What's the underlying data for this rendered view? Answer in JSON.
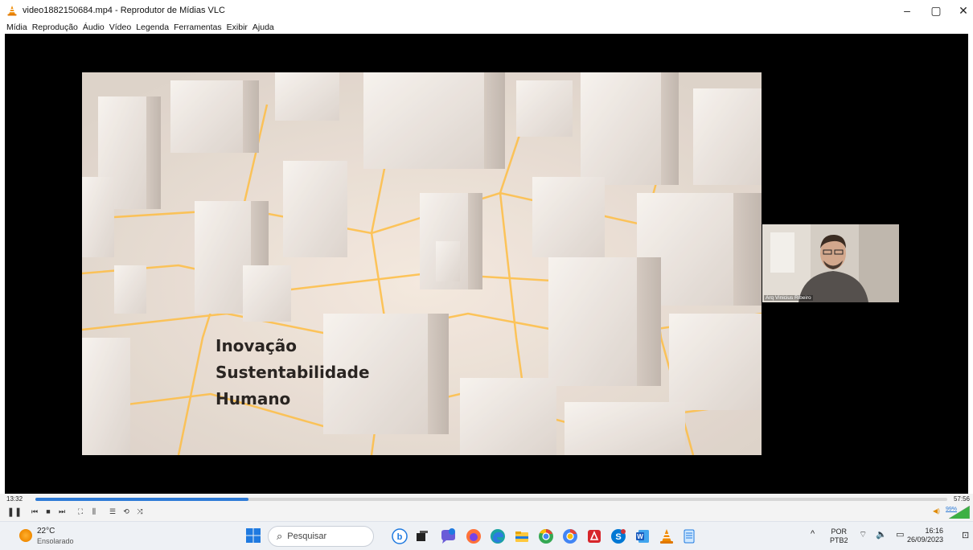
{
  "window": {
    "title": "video1882150684.mp4 - Reprodutor de Mídias VLC",
    "min": "–",
    "max": "▢",
    "close": "✕"
  },
  "menu": [
    "Mídia",
    "Reprodução",
    "Áudio",
    "Vídeo",
    "Legenda",
    "Ferramentas",
    "Exibir",
    "Ajuda"
  ],
  "slide": {
    "lines": [
      "Inovação",
      "Sustentabilidade",
      "Humano"
    ]
  },
  "webcam": {
    "name": "Arq Vinicius Ribeiro"
  },
  "player": {
    "time_current": "13:32",
    "time_total": "57:56",
    "progress_fraction": 0.234,
    "volume": "99%",
    "buttons": {
      "play_pause": "❚❚",
      "prev": "⏮",
      "stop": "■",
      "next": "⏭",
      "fullscreen": "⛶",
      "ext": "⫼",
      "playlist": "☰",
      "loop": "⟲",
      "random": "⤨"
    }
  },
  "taskbar": {
    "temp": "22°C",
    "condition": "Ensolarado",
    "search_placeholder": "Pesquisar",
    "lang1": "POR",
    "lang2": "PTB2",
    "time": "16:16",
    "date": "26/09/2023",
    "chevron": "^",
    "tray_icons": "⌔ 🔈 ▭"
  },
  "colors": {
    "seek_fill": "#2e7bd6",
    "vlc_orange": "#f08a00"
  }
}
